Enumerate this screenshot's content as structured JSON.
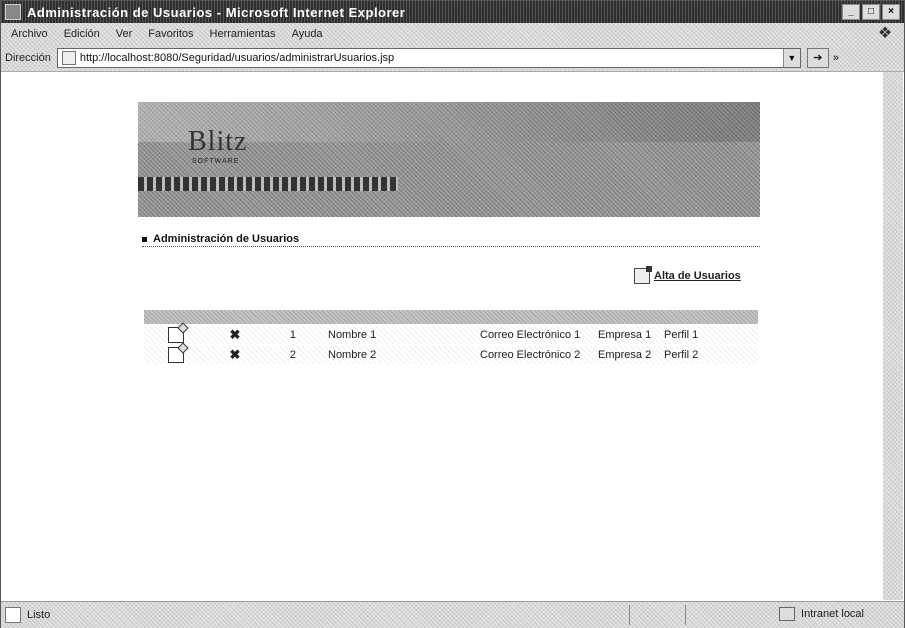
{
  "window": {
    "title": "Administración de Usuarios - Microsoft Internet Explorer"
  },
  "menu": [
    "Archivo",
    "Edición",
    "Ver",
    "Favoritos",
    "Herramientas",
    "Ayuda"
  ],
  "address": {
    "label": "Dirección",
    "url": "http://localhost:8080/Seguridad/usuarios/administrarUsuarios.jsp"
  },
  "banner": {
    "logo": "Blitz",
    "logo_sub": "SOFTWARE"
  },
  "section": {
    "title": "Administración de Usuarios"
  },
  "actions": {
    "alta": "Alta de Usuarios"
  },
  "users": [
    {
      "id": "1",
      "name": "Nombre 1",
      "email": "Correo Electrónico 1",
      "empresa": "Empresa 1",
      "perfil": "Perfil 1"
    },
    {
      "id": "2",
      "name": "Nombre 2",
      "email": "Correo Electrónico 2",
      "empresa": "Empresa 2",
      "perfil": "Perfil 2"
    }
  ],
  "status": {
    "text": "Listo",
    "zone": "Intranet local"
  }
}
